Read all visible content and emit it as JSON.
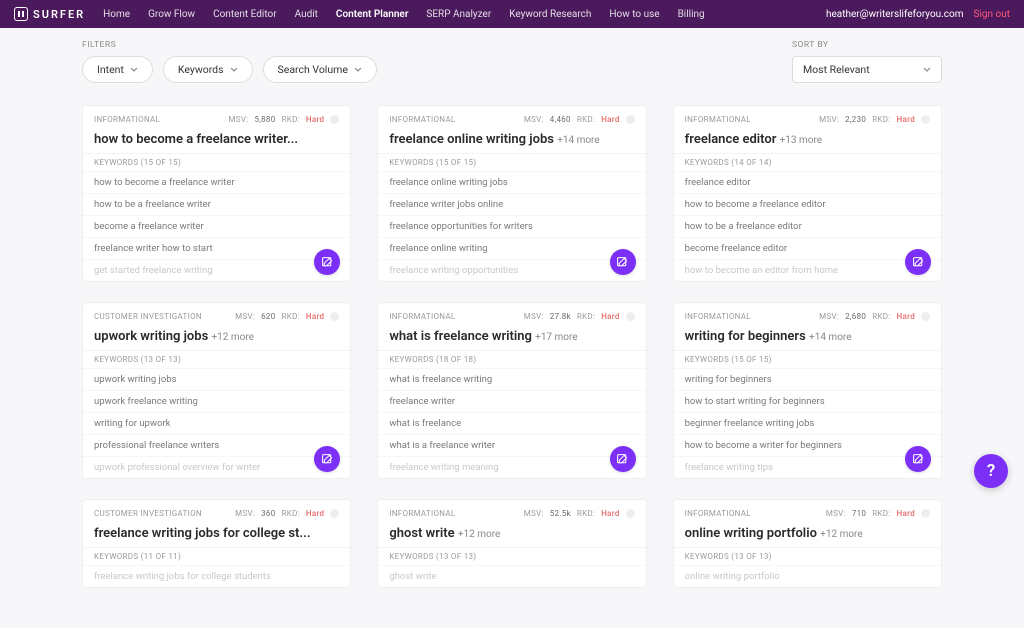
{
  "nav": {
    "brand": "SURFER",
    "links": [
      "Home",
      "Grow Flow",
      "Content Editor",
      "Audit",
      "Content Planner",
      "SERP Analyzer",
      "Keyword Research",
      "How to use",
      "Billing"
    ],
    "active_index": 4,
    "user_email": "heather@writerslifeforyou.com",
    "signout": "Sign out"
  },
  "filters": {
    "label": "FILTERS",
    "pills": [
      "Intent",
      "Keywords",
      "Search Volume"
    ]
  },
  "sort": {
    "label": "SORT BY",
    "value": "Most Relevant"
  },
  "labels": {
    "msv": "MSV:",
    "rkd": "RKD:",
    "keywords_prefix": "KEYWORDS"
  },
  "cards": [
    {
      "intent": "INFORMATIONAL",
      "msv": "5,880",
      "rkd": "Hard",
      "title": "how to become a freelance writer...",
      "more": "",
      "kw_count": "(15 OF 15)",
      "keywords": [
        {
          "text": "how to become a freelance writer"
        },
        {
          "text": "how to be a freelance writer"
        },
        {
          "text": "become a freelance writer"
        },
        {
          "text": "freelance writer how to start"
        },
        {
          "text": "get started freelance writing",
          "faded": true
        }
      ]
    },
    {
      "intent": "INFORMATIONAL",
      "msv": "4,460",
      "rkd": "Hard",
      "title": "freelance online writing jobs",
      "more": "+14 more",
      "kw_count": "(15 OF 15)",
      "keywords": [
        {
          "text": "freelance online writing jobs"
        },
        {
          "text": "freelance writer jobs online"
        },
        {
          "text": "freelance opportunities for writers"
        },
        {
          "text": "freelance online writing"
        },
        {
          "text": "freelance writing opportunities",
          "faded": true
        }
      ]
    },
    {
      "intent": "INFORMATIONAL",
      "msv": "2,230",
      "rkd": "Hard",
      "title": "freelance editor",
      "more": "+13 more",
      "kw_count": "(14 OF 14)",
      "keywords": [
        {
          "text": "freelance editor"
        },
        {
          "text": "how to become a freelance editor"
        },
        {
          "text": "how to be a freelance editor"
        },
        {
          "text": "become freelance editor"
        },
        {
          "text": "how to become an editor from home",
          "faded": true
        }
      ]
    },
    {
      "intent": "CUSTOMER INVESTIGATION",
      "msv": "620",
      "rkd": "Hard",
      "title": "upwork writing jobs",
      "more": "+12 more",
      "kw_count": "(13 OF 13)",
      "keywords": [
        {
          "text": "upwork writing jobs"
        },
        {
          "text": "upwork freelance writing"
        },
        {
          "text": "writing for upwork"
        },
        {
          "text": "professional freelance writers"
        },
        {
          "text": "upwork professional overview for writer",
          "faded": true
        }
      ]
    },
    {
      "intent": "INFORMATIONAL",
      "msv": "27.8k",
      "rkd": "Hard",
      "title": "what is freelance writing",
      "more": "+17 more",
      "kw_count": "(18 OF 18)",
      "keywords": [
        {
          "text": "what is freelance writing"
        },
        {
          "text": "freelance writer"
        },
        {
          "text": "what is freelance"
        },
        {
          "text": "what is a freelance writer"
        },
        {
          "text": "freelance writing meaning",
          "faded": true
        }
      ]
    },
    {
      "intent": "INFORMATIONAL",
      "msv": "2,680",
      "rkd": "Hard",
      "title": "writing for beginners",
      "more": "+14 more",
      "kw_count": "(15 OF 15)",
      "keywords": [
        {
          "text": "writing for beginners"
        },
        {
          "text": "how to start writing for beginners"
        },
        {
          "text": "beginner freelance writing jobs"
        },
        {
          "text": "how to become a writer for beginners"
        },
        {
          "text": "freelance writing tips",
          "faded": true
        }
      ]
    },
    {
      "intent": "CUSTOMER INVESTIGATION",
      "msv": "360",
      "rkd": "Hard",
      "title": "freelance writing jobs for college st...",
      "more": "",
      "kw_count": "(11 OF 11)",
      "keywords": [
        {
          "text": "freelance writing jobs for college students",
          "faded": true
        }
      ],
      "short": true
    },
    {
      "intent": "INFORMATIONAL",
      "msv": "52.5k",
      "rkd": "Hard",
      "title": "ghost write",
      "more": "+12 more",
      "kw_count": "(13 OF 13)",
      "keywords": [
        {
          "text": "ghost write",
          "faded": true
        }
      ],
      "short": true
    },
    {
      "intent": "INFORMATIONAL",
      "msv": "710",
      "rkd": "Hard",
      "title": "online writing portfolio",
      "more": "+12 more",
      "kw_count": "(13 OF 13)",
      "keywords": [
        {
          "text": "online writing portfolio",
          "faded": true
        }
      ],
      "short": true
    }
  ],
  "help": "?"
}
